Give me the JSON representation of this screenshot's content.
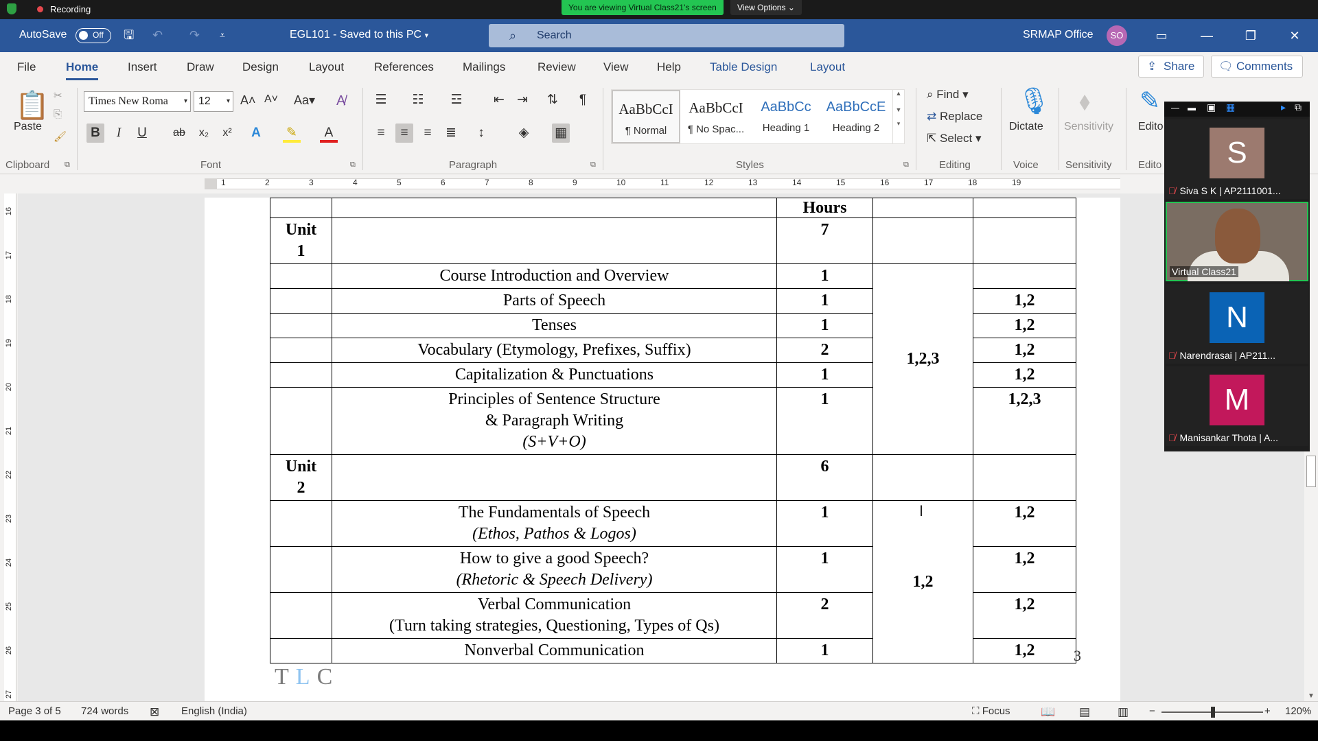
{
  "zoom": {
    "recording": "Recording",
    "viewing": "You are viewing Virtual Class21's screen",
    "view_options": "View Options"
  },
  "titlebar": {
    "autosave": "AutoSave",
    "toggle": "Off",
    "doc_title": "EGL101  -  Saved to this PC",
    "search_placeholder": "Search",
    "org": "SRMAP Office",
    "avatar_initials": "SO"
  },
  "tabs": [
    "File",
    "Home",
    "Insert",
    "Draw",
    "Design",
    "Layout",
    "References",
    "Mailings",
    "Review",
    "View",
    "Help",
    "Table Design",
    "Layout"
  ],
  "share": "Share",
  "comments": "Comments",
  "ribbon": {
    "paste": "Paste",
    "font_name": "Times New Roma",
    "font_size": "12",
    "styles": [
      {
        "preview": "AaBbCcI",
        "name": "¶ Normal"
      },
      {
        "preview": "AaBbCcI",
        "name": "¶ No Spac..."
      },
      {
        "preview": "AaBbCc",
        "name": "Heading 1"
      },
      {
        "preview": "AaBbCcE",
        "name": "Heading 2"
      }
    ],
    "find": "Find",
    "replace": "Replace",
    "select": "Select",
    "dictate": "Dictate",
    "sensitivity": "Sensitivity",
    "editor": "Edito",
    "groups": {
      "clipboard": "Clipboard",
      "font": "Font",
      "paragraph": "Paragraph",
      "styles": "Styles",
      "editing": "Editing",
      "voice": "Voice",
      "sensitivity": "Sensitivity",
      "editor": "Edito"
    }
  },
  "ruler": {
    "h": [
      "1",
      "2",
      "3",
      "4",
      "5",
      "6",
      "7",
      "8",
      "9",
      "10",
      "11",
      "12",
      "13",
      "14",
      "15",
      "16",
      "17",
      "18",
      "19"
    ],
    "v": [
      "16",
      "17",
      "18",
      "19",
      "20",
      "21",
      "22",
      "23",
      "24",
      "25",
      "26",
      "27"
    ]
  },
  "table": {
    "header_hours": "Hours",
    "unit1_label": [
      "Unit",
      "1"
    ],
    "unit1_hours": "7",
    "unit1_rows": [
      {
        "topic": [
          "Course Introduction and Overview"
        ],
        "hours": "1",
        "co": ""
      },
      {
        "topic": [
          "Parts of Speech"
        ],
        "hours": "1",
        "co": "1,2"
      },
      {
        "topic": [
          "Tenses"
        ],
        "hours": "1",
        "co": "1,2"
      },
      {
        "topic": [
          "Vocabulary (Etymology, Prefixes, Suffix)"
        ],
        "hours": "2",
        "co": "1,2"
      },
      {
        "topic": [
          "Capitalization & Punctuations"
        ],
        "hours": "1",
        "co": "1,2"
      },
      {
        "topic": [
          "Principles of Sentence Structure",
          "& Paragraph Writing",
          "(S+V+O)"
        ],
        "hours": "1",
        "co": "1,2,3"
      }
    ],
    "unit1_merged": "1,2,3",
    "unit2_label": [
      "Unit",
      "2"
    ],
    "unit2_hours": "6",
    "unit2_rows": [
      {
        "topic": [
          "The Fundamentals of Speech",
          "(Ethos, Pathos & Logos)"
        ],
        "hours": "1",
        "co": "1,2"
      },
      {
        "topic": [
          "How to give a good Speech?",
          "(Rhetoric & Speech Delivery)"
        ],
        "hours": "1",
        "co": "1,2"
      },
      {
        "topic": [
          "Verbal Communication",
          "(Turn taking strategies, Questioning, Types of Qs)"
        ],
        "hours": "2",
        "co": "1,2"
      },
      {
        "topic": [
          "Nonverbal Communication"
        ],
        "hours": "1",
        "co": "1,2"
      }
    ],
    "unit2_merged": "1,2"
  },
  "page_number": "3",
  "logo_letters": "TLC",
  "status": {
    "page": "Page 3 of 5",
    "words": "724 words",
    "language": "English (India)",
    "focus": "Focus",
    "zoom": "120%"
  },
  "participants": [
    {
      "initial": "S",
      "name": "Siva S K | AP2111001...",
      "color": "#9c7a6f"
    },
    {
      "initial": "",
      "name": "Virtual Class21",
      "color": ""
    },
    {
      "initial": "N",
      "name": "Narendrasai  | AP211...",
      "color": "#0a63b5"
    },
    {
      "initial": "M",
      "name": "Manisankar Thota | A...",
      "color": "#c2185b"
    }
  ]
}
